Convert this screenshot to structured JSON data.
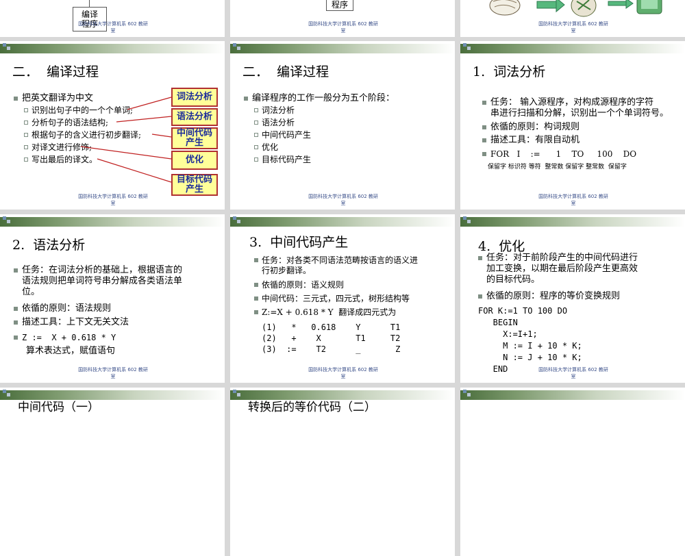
{
  "footer": [
    "国防科技大学计算机系 602 教研",
    "室"
  ],
  "top_row": {
    "left_box": [
      "编译",
      "程序"
    ],
    "mid_box": "程序"
  },
  "slide4": {
    "title": "二．  编译过程",
    "bullet": "把英文翻译为中文",
    "subs": [
      "识别出句子中的一个个单词;",
      "分析句子的语法结构;",
      "根据句子的含义进行初步翻译;",
      "对译文进行修饰;",
      "写出最后的译文。"
    ],
    "boxes": [
      [
        "词法分析"
      ],
      [
        "语法分析"
      ],
      [
        "中间代码",
        "产生"
      ],
      [
        "优化"
      ],
      [
        "目标代码",
        "产生"
      ]
    ]
  },
  "slide5": {
    "title": "二．  编译过程",
    "bullet": "编译程序的工作一般分为五个阶段：",
    "subs": [
      "词法分析",
      "语法分析",
      "中间代码产生",
      "优化",
      "目标代码产生"
    ]
  },
  "slide6": {
    "title": "1.  词法分析",
    "b1": [
      "任务：  输入源程序，对构成源程序的字符",
      "串进行扫描和分解，识别出一个个单词符号。"
    ],
    "b2": "依循的原则：构词规则",
    "b3": "描述工具：有限自动机",
    "b4": "FOR   I    :=      1    TO     100    DO",
    "labels": "保留字 标识符 等符  整常数 保留字 整常数  保留字"
  },
  "slide7": {
    "title": "2.  语法分析",
    "b1": [
      "任务：在词法分析的基础上，根据语言的",
      "语法规则把单词符号串分解成各类语法单",
      "位。"
    ],
    "b2": "依循的原则：语法规则",
    "b3": "描述工具：上下文无关文法",
    "b4": "Z :=  X + 0.618 * Y",
    "b4sub": "算术表达式，赋值语句"
  },
  "slide8": {
    "title": "3.  中间代码产生",
    "b1": [
      "任务：对各类不同语法范畴按语言的语义进",
      "行初步翻译。"
    ],
    "b2": "依循的原则：语义规则",
    "b3": "中间代码：三元式，四元式，树形结构等",
    "b4": "Z:=X + 0.618 * Y  翻译成四元式为",
    "rows": [
      "(1)   *   0.618    Y      T1",
      "(2)   +    X       T1     T2",
      "(3)  :=    T2      _       Z"
    ]
  },
  "slide9": {
    "title": "4.  优化",
    "b1": [
      "任务：对于前阶段产生的中间代码进行",
      "加工变换，以期在最后阶段产生更高效",
      "的目标代码。"
    ],
    "b2": "依循的原则：程序的等价变换规则",
    "code": [
      "FOR K:=1 TO 100 DO",
      "   BEGIN",
      "     X:=I+1;",
      "     M := I + 10 * K;",
      "     N := J + 10 * K;",
      "   END"
    ]
  },
  "slide10": {
    "title": "中间代码（一）"
  },
  "slide11": {
    "title": "转换后的等价代码（二）"
  }
}
